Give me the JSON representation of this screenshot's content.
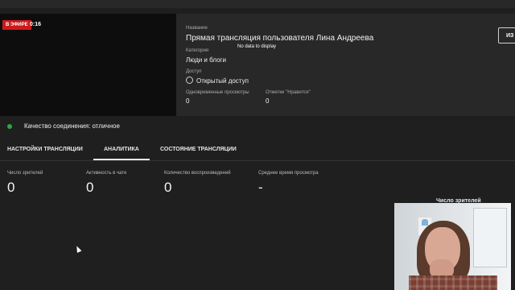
{
  "preview": {
    "live_label": "В ЭФИРЕ",
    "time": "0:16"
  },
  "details": {
    "title_label": "Название",
    "title": "Прямая трансляция пользователя Лина Андреева",
    "category_label": "Категория",
    "category": "Люди и блоги",
    "access_label": "Доступ",
    "access": "Открытый доступ",
    "concurrent_label": "Одновременные просмотры",
    "concurrent_value": "0",
    "likes_label": "Отметки \"Нравится\"",
    "likes_value": "0",
    "no_data": "No data to display",
    "edit_button": "ИЗ"
  },
  "quality": {
    "text": "Качество соединения: отличное",
    "status_color": "#2ba640"
  },
  "tabs": [
    {
      "label": "НАСТРОЙКИ ТРАНСЛЯЦИИ",
      "active": false
    },
    {
      "label": "АНАЛИТИКА",
      "active": true
    },
    {
      "label": "СОСТОЯНИЕ ТРАНСЛЯЦИИ",
      "active": false
    }
  ],
  "metrics": [
    {
      "label": "Число зрителей",
      "value": "0"
    },
    {
      "label": "Активность в чате",
      "value": "0"
    },
    {
      "label": "Количество воспроизведений",
      "value": "0"
    },
    {
      "label": "Среднее время просмотра",
      "value": "-"
    }
  ],
  "chart": {
    "title": "Число зрителей"
  },
  "colors": {
    "live_badge": "#cc1a1a",
    "background": "#1f1f1f",
    "panel": "#282828"
  }
}
